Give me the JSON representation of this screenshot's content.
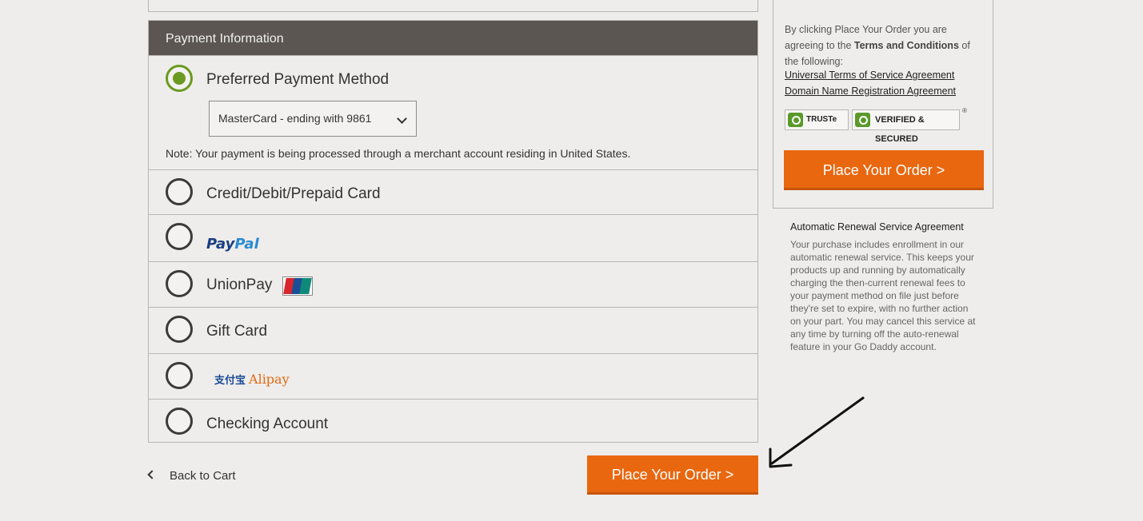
{
  "payment": {
    "header": "Payment Information",
    "preferred": {
      "label": "Preferred Payment Method",
      "selected_card": "MasterCard - ending with 9861",
      "note": "Note: Your payment is being processed through a merchant account residing in United States."
    },
    "options": {
      "credit": "Credit/Debit/Prepaid Card",
      "paypal_part1": "Pay",
      "paypal_part2": "Pal",
      "unionpay": "UnionPay",
      "gift": "Gift Card",
      "alipay_cn": "支付宝",
      "alipay_en": "Alipay",
      "checking": "Checking Account"
    }
  },
  "footer": {
    "back_label": "Back to Cart",
    "order_button": "Place Your Order >"
  },
  "side": {
    "agree_prefix": "By clicking Place Your Order you are agreeing to the ",
    "agree_bold": "Terms and Conditions",
    "agree_suffix": " of the following:",
    "link_tos": "Universal Terms of Service Agreement",
    "link_domain": "Domain Name Registration Agreement",
    "badge_truste": "TRUSTe",
    "badge_verified": "VERIFIED & SECURED",
    "reg_mark": "®",
    "order_button": "Place Your Order >"
  },
  "renewal": {
    "title": "Automatic Renewal Service Agreement",
    "body": "Your purchase includes enrollment in our automatic renewal service. This keeps your products up and running by automatically charging the then-current renewal fees to your payment method on file just before they're set to expire, with no further action on your part. You may cancel this service at any time by turning off the auto-renewal feature in your Go Daddy account."
  },
  "colors": {
    "accent_orange": "#e8670f",
    "header_bg": "#5b5651",
    "radio_selected": "#6a9a1f"
  }
}
